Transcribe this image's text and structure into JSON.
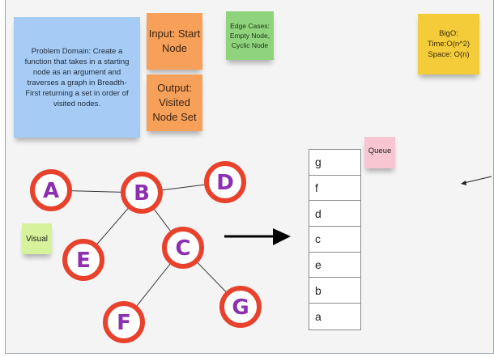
{
  "notes": {
    "problem_domain": "Problem Domain: Create a function that takes in a starting node as an argument and traverses a graph in Breadth-First returning a set in order of visited nodes.",
    "input": "Input: Start Node",
    "output": "Output: Visited Node Set",
    "edge_cases": "Edge Cases: Empty Node, Cyclic Node",
    "big_o": "BigO: Time:O(n^2) Space: O(n)",
    "visual": "Visual",
    "queue": "Queue"
  },
  "graph": {
    "nodes": [
      {
        "id": "A",
        "label": "A"
      },
      {
        "id": "B",
        "label": "B"
      },
      {
        "id": "D",
        "label": "D"
      },
      {
        "id": "E",
        "label": "E"
      },
      {
        "id": "C",
        "label": "C"
      },
      {
        "id": "F",
        "label": "F"
      },
      {
        "id": "G",
        "label": "G"
      }
    ],
    "edges": [
      [
        "A",
        "B"
      ],
      [
        "B",
        "D"
      ],
      [
        "B",
        "E"
      ],
      [
        "B",
        "C"
      ],
      [
        "C",
        "F"
      ],
      [
        "C",
        "G"
      ]
    ],
    "node_stroke_color": "#e8412c",
    "letter_color": "#8d2fb0"
  },
  "queue": {
    "items": [
      "g",
      "f",
      "d",
      "c",
      "e",
      "b",
      "a"
    ]
  }
}
